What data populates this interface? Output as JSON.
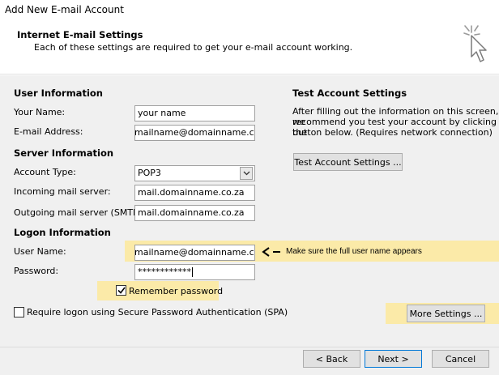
{
  "window": {
    "title": "Add New E-mail Account"
  },
  "header": {
    "title": "Internet E-mail Settings",
    "subtitle": "Each of these settings are required to get your e-mail account working."
  },
  "user_info": {
    "section_label": "User Information",
    "your_name_label": "Your Name:",
    "your_name_value": "your name",
    "email_label": "E-mail Address:",
    "email_value": "mailname@domainname.co.za"
  },
  "server_info": {
    "section_label": "Server Information",
    "account_type_label": "Account Type:",
    "account_type_value": "POP3",
    "incoming_label": "Incoming mail server:",
    "incoming_value": "mail.domainname.co.za",
    "outgoing_label": "Outgoing mail server (SMTP):",
    "outgoing_value": "mail.domainname.co.za"
  },
  "logon_info": {
    "section_label": "Logon Information",
    "username_label": "User Name:",
    "username_value": "mailname@domainname.co.za",
    "password_label": "Password:",
    "password_value": "************",
    "remember_label": "Remember password",
    "remember_checked": true,
    "spa_label": "Require logon using Secure Password Authentication (SPA)",
    "spa_checked": false
  },
  "annotation": {
    "arrow": "<",
    "text": "Make sure the full user name appears"
  },
  "test_settings": {
    "section_label": "Test Account Settings",
    "description_lines": [
      "After filling out the information on this screen, we",
      "recommend you test your account by clicking the",
      "button below. (Requires network connection)"
    ],
    "test_button_label": "Test Account Settings ..."
  },
  "buttons": {
    "more_settings": "More Settings ...",
    "back": "< Back",
    "next": "Next >",
    "cancel": "Cancel"
  },
  "colors": {
    "highlight": "#fbeaa8",
    "panel_bg": "#f0f0f0",
    "default_button_border": "#0078d7"
  },
  "icons": {
    "header": "cursor-click-icon",
    "dropdown": "chevron-down-icon",
    "checkbox": "check-icon"
  }
}
